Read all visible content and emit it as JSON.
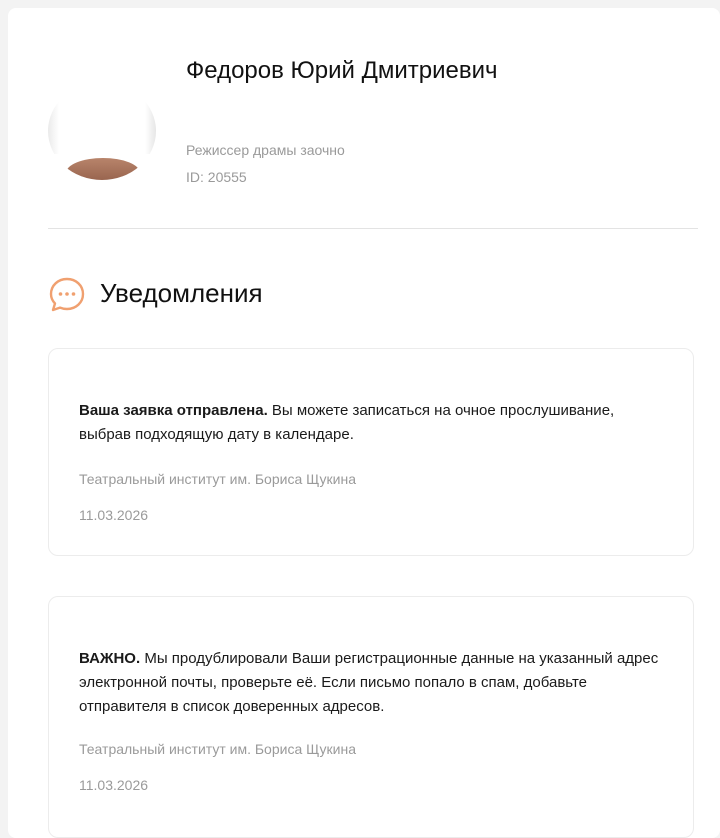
{
  "profile": {
    "name": "Федоров Юрий Дмитриевич",
    "role": "Режиссер драмы заочно",
    "id": "ID: 20555"
  },
  "notifications": {
    "title": "Уведомления",
    "accent_color": "#f0a070",
    "items": [
      {
        "bold": "Ваша заявка отправлена.",
        "text": " Вы можете записаться на очное прослушивание, выбрав подходящую дату в календаре.",
        "source": "Театральный институт им. Бориса Щукина",
        "date": "11.03.2026"
      },
      {
        "bold": "ВАЖНО.",
        "text": " Мы продублировали Ваши регистрационные данные на указанный адрес электронной почты, проверьте её. Если письмо попало в спам, добавьте отправителя в список доверенных адресов.",
        "source": "Театральный институт им. Бориса Щукина",
        "date": "11.03.2026"
      }
    ]
  }
}
